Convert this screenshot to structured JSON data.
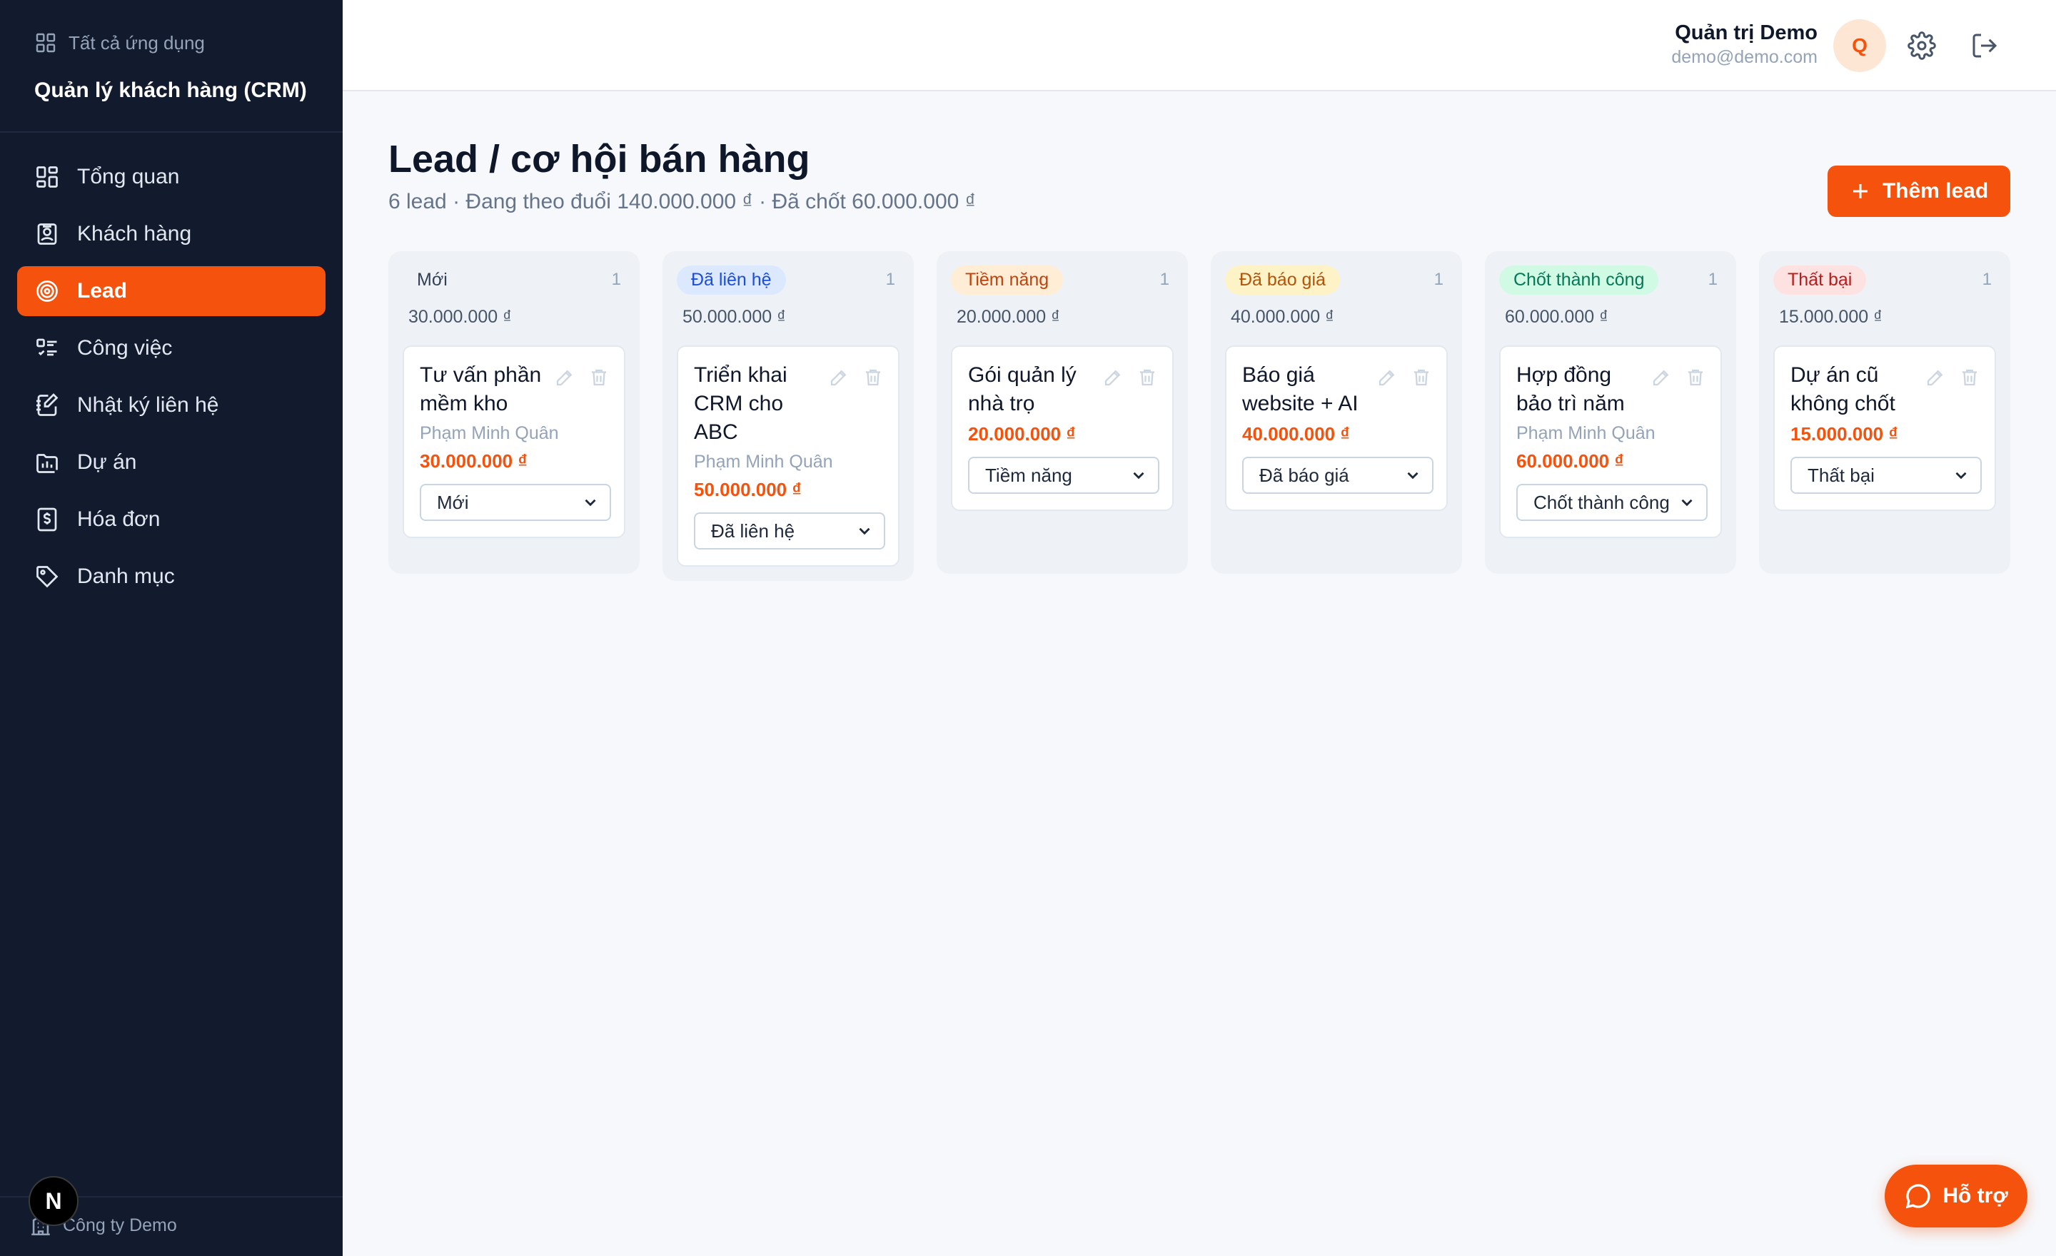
{
  "sidebar": {
    "all_apps": "Tất cả ứng dụng",
    "app_title": "Quản lý khách hàng (CRM)",
    "items": [
      {
        "label": "Tổng quan",
        "icon": "dashboard-icon",
        "active": false
      },
      {
        "label": "Khách hàng",
        "icon": "contact-card-icon",
        "active": false
      },
      {
        "label": "Lead",
        "icon": "target-icon",
        "active": true
      },
      {
        "label": "Công việc",
        "icon": "task-list-icon",
        "active": false
      },
      {
        "label": "Nhật ký liên hệ",
        "icon": "notebook-icon",
        "active": false
      },
      {
        "label": "Dự án",
        "icon": "project-chart-icon",
        "active": false
      },
      {
        "label": "Hóa đơn",
        "icon": "invoice-icon",
        "active": false
      },
      {
        "label": "Danh mục",
        "icon": "tag-icon",
        "active": false
      }
    ],
    "company": "Công ty Demo",
    "n_badge": "N"
  },
  "header": {
    "user_name": "Quản trị Demo",
    "user_email": "demo@demo.com",
    "avatar_letter": "Q"
  },
  "page": {
    "title": "Lead / cơ hội bán hàng",
    "subtitle": "6 lead · Đang theo đuổi 140.000.000 ₫ · Đã chốt 60.000.000 ₫",
    "add_button": "Thêm lead"
  },
  "columns": [
    {
      "label": "Mới",
      "count": "1",
      "total": "30.000.000 ₫",
      "badge_bg": "#eef2f7",
      "badge_fg": "#334155",
      "cards": [
        {
          "title": "Tư vấn phần mềm kho",
          "owner": "Phạm Minh Quân",
          "value": "30.000.000 ₫",
          "status": "Mới"
        }
      ]
    },
    {
      "label": "Đã liên hệ",
      "count": "1",
      "total": "50.000.000 ₫",
      "badge_bg": "#dbe8fe",
      "badge_fg": "#1d4ed8",
      "cards": [
        {
          "title": "Triển khai CRM cho ABC",
          "owner": "Phạm Minh Quân",
          "value": "50.000.000 ₫",
          "status": "Đã liên hệ"
        }
      ]
    },
    {
      "label": "Tiềm năng",
      "count": "1",
      "total": "20.000.000 ₫",
      "badge_bg": "#ffedd5",
      "badge_fg": "#c2410c",
      "cards": [
        {
          "title": "Gói quản lý nhà trọ",
          "owner": "",
          "value": "20.000.000 ₫",
          "status": "Tiềm năng"
        }
      ]
    },
    {
      "label": "Đã báo giá",
      "count": "1",
      "total": "40.000.000 ₫",
      "badge_bg": "#fef3c7",
      "badge_fg": "#b45309",
      "cards": [
        {
          "title": "Báo giá website + AI",
          "owner": "",
          "value": "40.000.000 ₫",
          "status": "Đã báo giá"
        }
      ]
    },
    {
      "label": "Chốt thành công",
      "count": "1",
      "total": "60.000.000 ₫",
      "badge_bg": "#d1fae5",
      "badge_fg": "#047857",
      "cards": [
        {
          "title": "Hợp đồng bảo trì năm",
          "owner": "Phạm Minh Quân",
          "value": "60.000.000 ₫",
          "status": "Chốt thành công"
        }
      ]
    },
    {
      "label": "Thất bại",
      "count": "1",
      "total": "15.000.000 ₫",
      "badge_bg": "#fee2e2",
      "badge_fg": "#b91c1c",
      "cards": [
        {
          "title": "Dự án cũ không chốt",
          "owner": "",
          "value": "15.000.000 ₫",
          "status": "Thất bại"
        }
      ]
    }
  ],
  "help_button": "Hỗ trợ"
}
